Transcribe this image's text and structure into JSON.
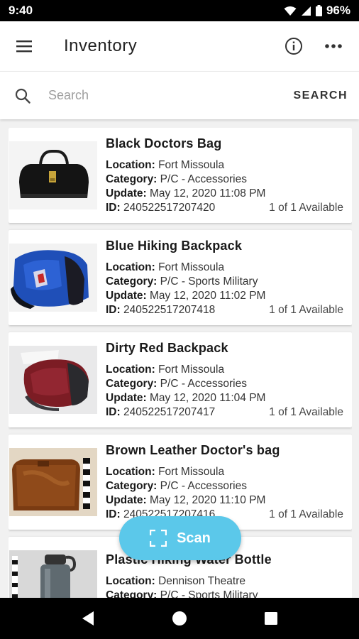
{
  "status_bar": {
    "time": "9:40",
    "battery": "96%"
  },
  "app_bar": {
    "title": "Inventory",
    "icons": [
      "menu-icon",
      "info-icon",
      "more-icon"
    ]
  },
  "search": {
    "placeholder": "Search",
    "action_label": "SEARCH"
  },
  "labels": {
    "location": "Location:",
    "category": "Category:",
    "update": "Update:",
    "id": "ID:"
  },
  "items": [
    {
      "name": "Black Doctors Bag",
      "location": "Fort Missoula",
      "category": "P/C - Accessories",
      "update": "May 12, 2020 11:08 PM",
      "id": "240522517207420",
      "availability": "1 of 1 Available"
    },
    {
      "name": "Blue Hiking Backpack",
      "location": "Fort Missoula",
      "category": "P/C - Sports Military",
      "update": "May 12, 2020 11:02 PM",
      "id": "240522517207418",
      "availability": "1 of 1 Available"
    },
    {
      "name": "Dirty Red Backpack",
      "location": "Fort Missoula",
      "category": "P/C - Accessories",
      "update": "May 12, 2020 11:04 PM",
      "id": "240522517207417",
      "availability": "1 of 1 Available"
    },
    {
      "name": "Brown Leather Doctor's bag",
      "location": "Fort Missoula",
      "category": "P/C - Accessories",
      "update": "May 12, 2020 11:10 PM",
      "id": "240522517207416",
      "availability": "1 of 1 Available"
    },
    {
      "name": "Plastic Hiking Water Bottle",
      "location": "Dennison Theatre",
      "category": "P/C - Sports Military",
      "update": "",
      "id": "",
      "availability": ""
    }
  ],
  "fab": {
    "label": "Scan",
    "icon": "scan-icon"
  },
  "colors": {
    "accent": "#5bc8ea",
    "background": "#f1f1f1",
    "card": "#ffffff"
  },
  "nav_bar": {
    "icons": [
      "back-icon",
      "home-icon",
      "recents-icon"
    ]
  }
}
